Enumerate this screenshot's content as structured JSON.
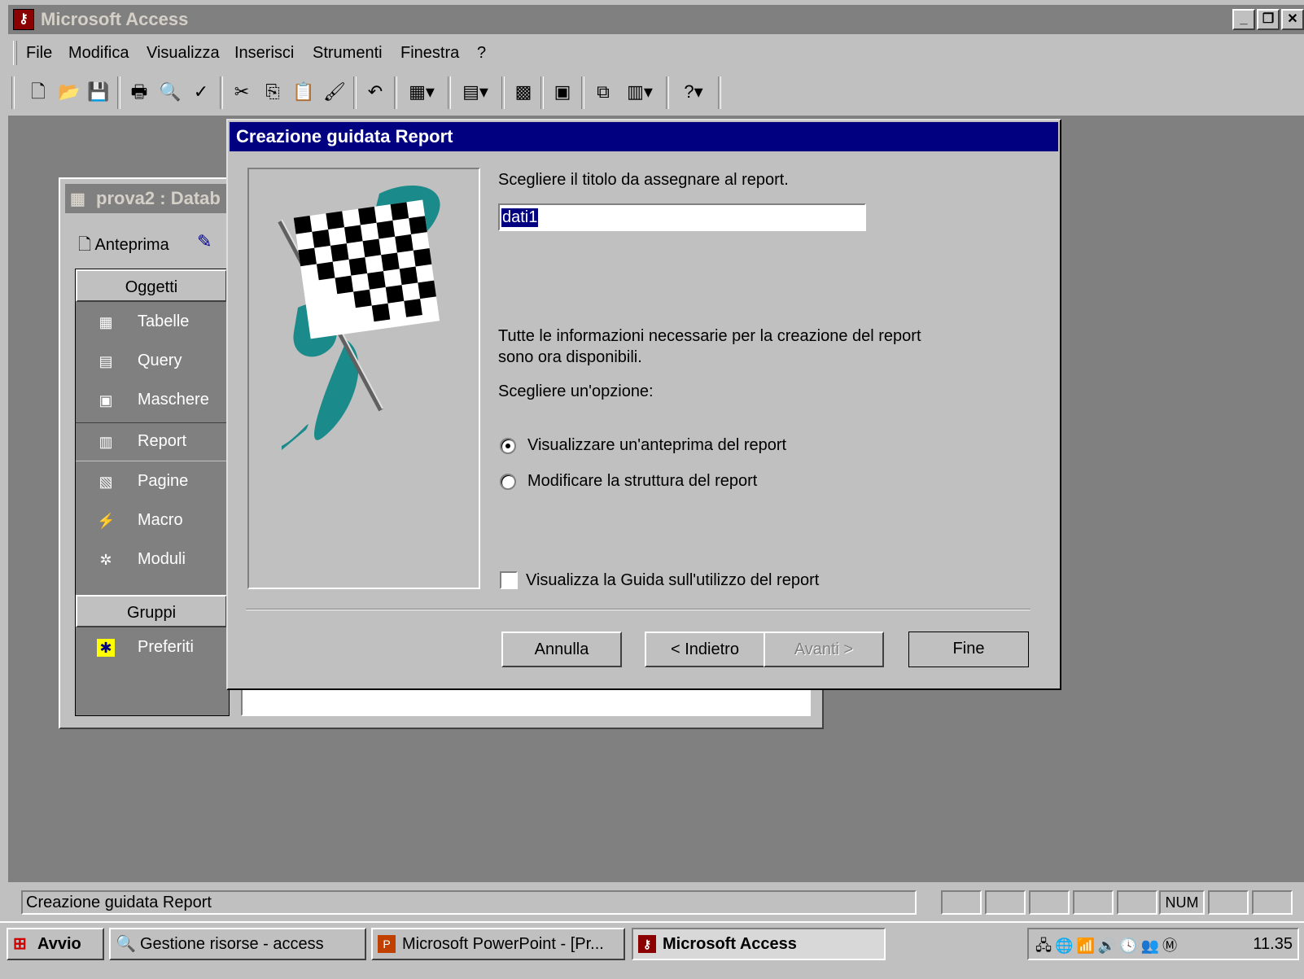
{
  "app": {
    "title": "Microsoft Access"
  },
  "menu": {
    "items": [
      "File",
      "Modifica",
      "Visualizza",
      "Inserisci",
      "Strumenti",
      "Finestra",
      "?"
    ]
  },
  "toolbar": {
    "icons": [
      "new-icon",
      "open-icon",
      "save-icon",
      "print-icon",
      "print-preview-icon",
      "spelling-icon",
      "cut-icon",
      "copy-icon",
      "paste-icon",
      "format-painter-icon",
      "undo-icon",
      "office-links-icon",
      "analyze-icon",
      "code-icon",
      "properties-icon",
      "relationships-icon",
      "new-object-icon",
      "help-icon"
    ]
  },
  "db_window": {
    "title": "prova2 : Datab",
    "preview_label": "Anteprima",
    "objects_header": "Oggetti",
    "groups_header": "Gruppi",
    "objects": [
      "Tabelle",
      "Query",
      "Maschere",
      "Report",
      "Pagine",
      "Macro",
      "Moduli"
    ],
    "selected": "Report",
    "favorites": "Preferiti"
  },
  "dialog": {
    "title": "Creazione guidata Report",
    "prompt": "Scegliere il titolo da assegnare al report.",
    "title_value": "dati1",
    "info_line1": "Tutte le informazioni necessarie per la creazione del report",
    "info_line2": "sono ora disponibili.",
    "choose": "Scegliere un'opzione:",
    "option_preview": "Visualizzare un'anteprima del report",
    "option_modify": "Modificare la struttura del report",
    "selected_option": "preview",
    "help_checkbox": "Visualizza la Guida sull'utilizzo del report",
    "help_checked": false,
    "buttons": {
      "cancel": "Annulla",
      "back": "< Indietro",
      "next": "Avanti >",
      "finish": "Fine"
    }
  },
  "status": {
    "text": "Creazione guidata Report",
    "num": "NUM"
  },
  "taskbar": {
    "start": "Avvio",
    "tasks": [
      "Gestione risorse - access",
      "Microsoft PowerPoint - [Pr...",
      "Microsoft Access"
    ],
    "active": "Microsoft Access",
    "clock": "11.35"
  },
  "colors": {
    "workspace": "#808080",
    "dialog_title": "#000080",
    "flag_teal": "#1a8a8a"
  }
}
